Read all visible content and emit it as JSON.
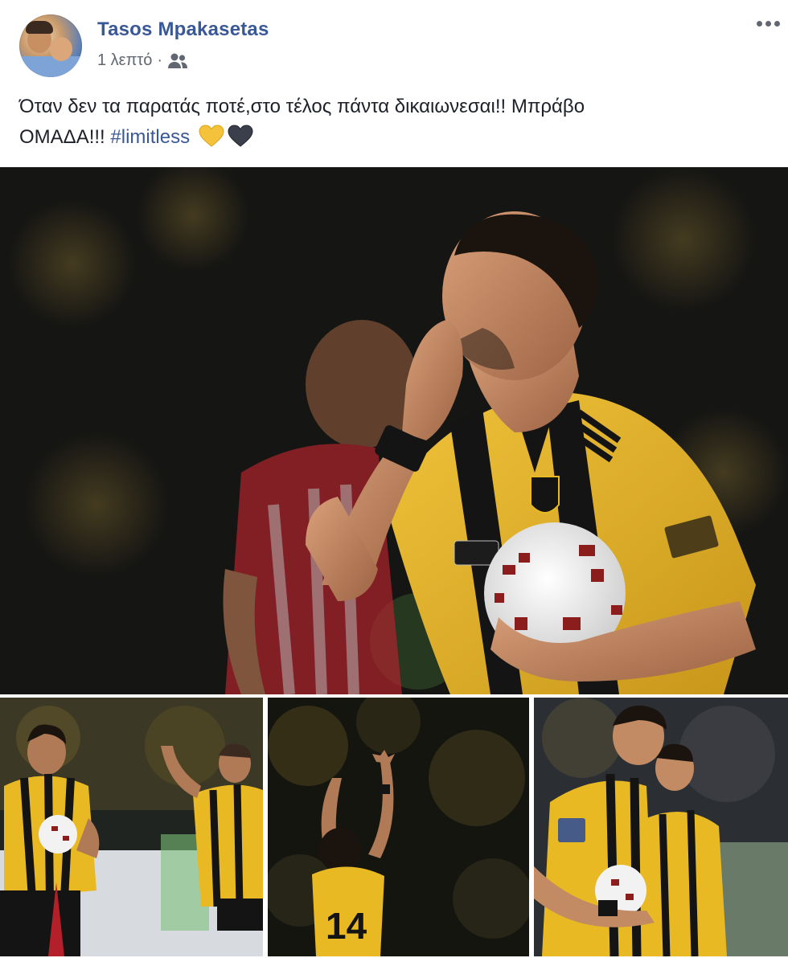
{
  "post": {
    "author_name": "Tasos Mpakasetas",
    "timestamp": "1 λεπτό",
    "separator": "·",
    "audience_icon": "friends-icon",
    "more_icon": "more-options-icon",
    "text_line1": "Όταν δεν τα παρατάς ποτέ,στο τέλος πάντα δικαιωνεσαι!! Μπράβο",
    "text_line2": "ΟΜΑΔΑ!!!",
    "hashtag": "#limitless",
    "emojis": [
      "yellow-heart-icon",
      "black-heart-icon"
    ]
  },
  "colors": {
    "link": "#385898",
    "meta": "#606770",
    "text": "#1d2129",
    "kit_yellow": "#e8b923",
    "kit_black": "#141414",
    "opponent_red": "#b3202a"
  },
  "photos": {
    "main": "player-kissing-hand-photo",
    "thumbnails": [
      "player-with-ball-photo",
      "player-arms-raised-photo",
      "players-celebrating-photo"
    ]
  }
}
